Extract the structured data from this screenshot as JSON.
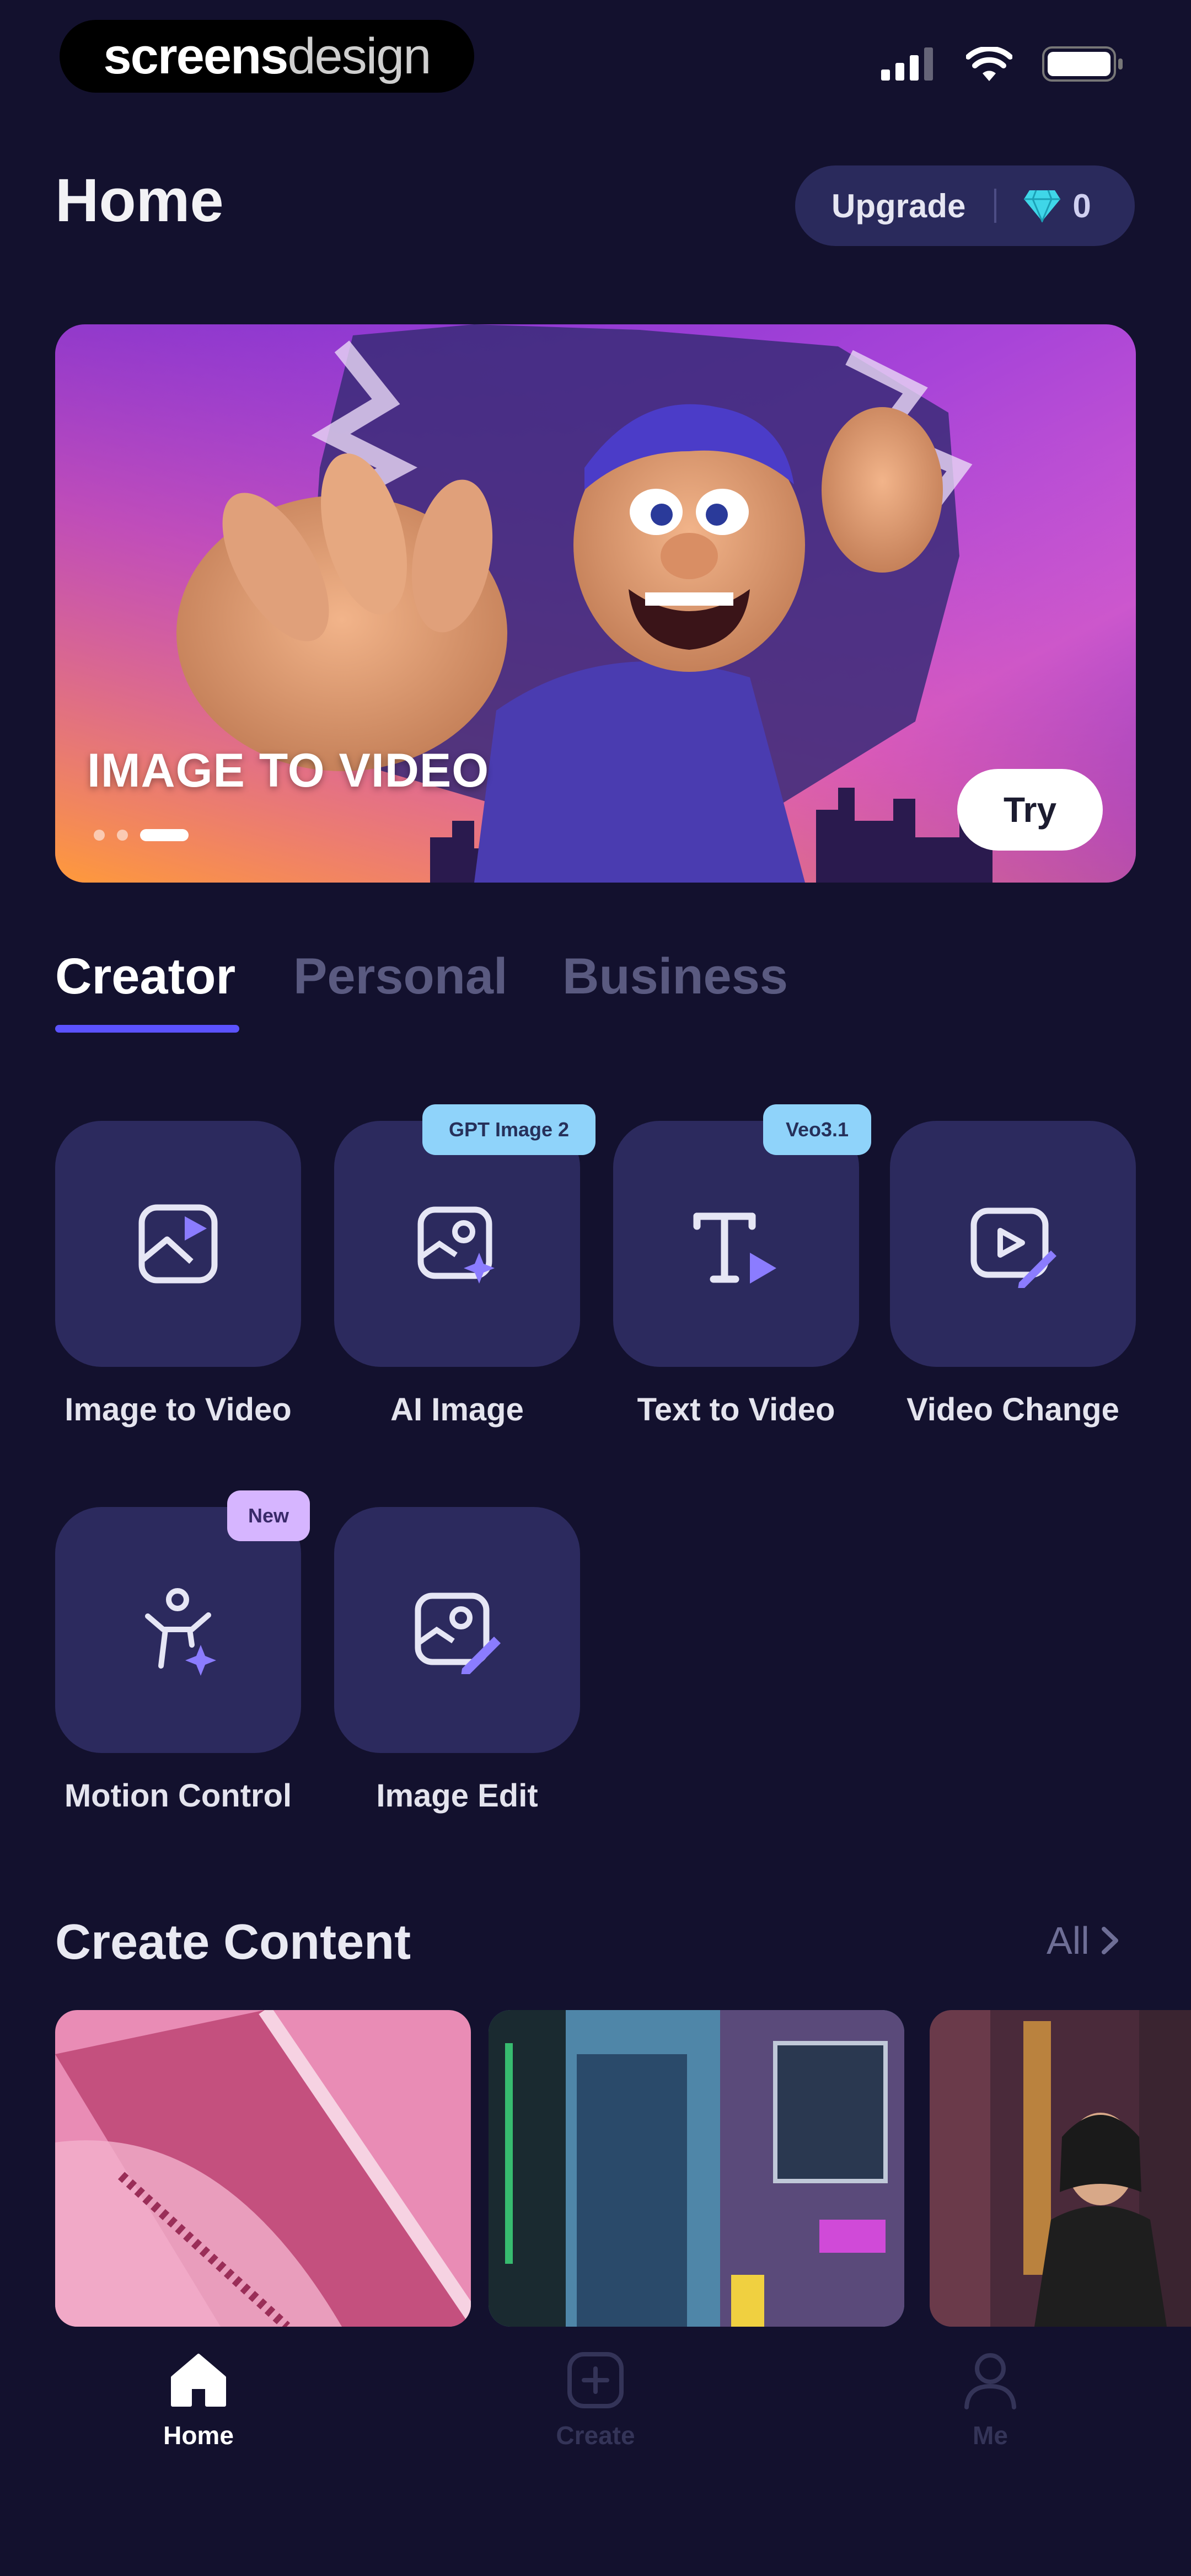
{
  "status_bar": {
    "brand_bold": "screens",
    "brand_light": "design",
    "icons": [
      "signal-icon",
      "wifi-icon",
      "battery-icon"
    ]
  },
  "header": {
    "title": "Home",
    "upgrade_label": "Upgrade",
    "gem_icon": "diamond-icon",
    "gem_count": "0"
  },
  "banner": {
    "title": "IMAGE TO VIDEO",
    "try_label": "Try",
    "slide_count": 3,
    "active_slide": 3
  },
  "tabs": [
    {
      "label": "Creator",
      "active": true
    },
    {
      "label": "Personal",
      "active": false
    },
    {
      "label": "Business",
      "active": false
    }
  ],
  "tools": [
    {
      "label": "Image to Video",
      "icon": "image-to-video-icon",
      "badge": ""
    },
    {
      "label": "AI Image",
      "icon": "ai-image-icon",
      "badge": "GPT Image 2"
    },
    {
      "label": "Text to Video",
      "icon": "text-to-video-icon",
      "badge": "Veo3.1"
    },
    {
      "label": "Video Change",
      "icon": "video-change-icon",
      "badge": ""
    },
    {
      "label": "Motion Control",
      "icon": "motion-control-icon",
      "badge": "New"
    },
    {
      "label": "Image Edit",
      "icon": "image-edit-icon",
      "badge": ""
    }
  ],
  "create_content": {
    "title": "Create Content",
    "all_label": "All",
    "thumbnails": [
      "pink-fabric-thumbnail",
      "neon-city-thumbnail",
      "woman-street-thumbnail"
    ]
  },
  "bottom_nav": [
    {
      "label": "Home",
      "icon": "home-icon",
      "active": true
    },
    {
      "label": "Create",
      "icon": "create-plus-icon",
      "active": false
    },
    {
      "label": "Me",
      "icon": "profile-icon",
      "active": false
    }
  ],
  "colors": {
    "background": "#13112e",
    "tile": "#2c2a5e",
    "accent": "#5b52ff",
    "badge_blue": "#8fd3fa",
    "badge_purple": "#d6b5ff"
  }
}
